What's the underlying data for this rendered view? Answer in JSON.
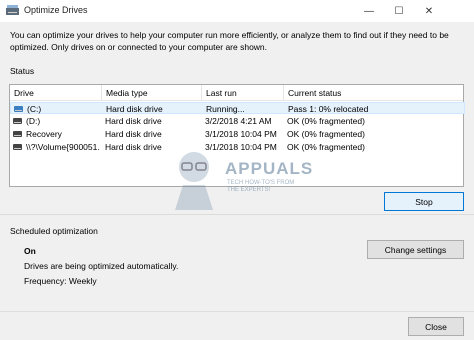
{
  "window": {
    "title": "Optimize Drives",
    "minimize_glyph": "—",
    "maximize_glyph": "☐",
    "close_glyph": "✕"
  },
  "intro_text": "You can optimize your drives to help your computer run more efficiently, or analyze them to find out if they need to be optimized. Only drives on or connected to your computer are shown.",
  "status": {
    "label": "Status",
    "columns": [
      "Drive",
      "Media type",
      "Last run",
      "Current status"
    ],
    "rows": [
      {
        "drive": "(C:)",
        "media": "Hard disk drive",
        "last_run": "Running...",
        "status": "Pass 1: 0% relocated",
        "icon": "system-drive-icon"
      },
      {
        "drive": "(D:)",
        "media": "Hard disk drive",
        "last_run": "3/2/2018 4:21 AM",
        "status": "OK (0% fragmented)",
        "icon": "drive-icon"
      },
      {
        "drive": "Recovery",
        "media": "Hard disk drive",
        "last_run": "3/1/2018 10:04 PM",
        "status": "OK (0% fragmented)",
        "icon": "drive-icon"
      },
      {
        "drive": "\\\\?\\Volume{900051...",
        "media": "Hard disk drive",
        "last_run": "3/1/2018 10:04 PM",
        "status": "OK (0% fragmented)",
        "icon": "drive-icon"
      }
    ],
    "stop_label": "Stop"
  },
  "scheduled": {
    "label": "Scheduled optimization",
    "state": "On",
    "description": "Drives are being optimized automatically.",
    "frequency": "Frequency: Weekly",
    "change_label": "Change settings"
  },
  "close_label": "Close",
  "watermark": {
    "title": "APPUALS",
    "subtitle": "TECH HOW-TO'S FROM THE EXPERTS!"
  }
}
